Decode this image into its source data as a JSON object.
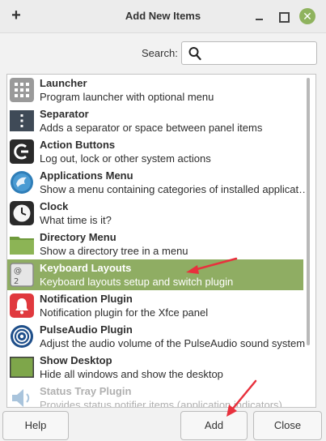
{
  "window": {
    "title": "Add New Items",
    "new_symbol": "+",
    "close_symbol": "✕"
  },
  "search": {
    "label": "Search:",
    "value": "",
    "placeholder": ""
  },
  "items": [
    {
      "name": "Launcher",
      "description": "Program launcher with optional menu",
      "icon": "launcher-grid-icon"
    },
    {
      "name": "Separator",
      "description": "Adds a separator or space between panel items",
      "icon": "separator-icon"
    },
    {
      "name": "Action Buttons",
      "description": "Log out, lock or other system actions",
      "icon": "action-buttons-icon"
    },
    {
      "name": "Applications Menu",
      "description": "Show a menu containing categories of installed applications",
      "icon": "applications-menu-icon"
    },
    {
      "name": "Clock",
      "description": "What time is it?",
      "icon": "clock-icon"
    },
    {
      "name": "Directory Menu",
      "description": "Show a directory tree in a menu",
      "icon": "folder-icon"
    },
    {
      "name": "Keyboard Layouts",
      "description": "Keyboard layouts setup and switch plugin",
      "icon": "keyboard-key-icon"
    },
    {
      "name": "Notification Plugin",
      "description": "Notification plugin for the Xfce panel",
      "icon": "bell-icon"
    },
    {
      "name": "PulseAudio Plugin",
      "description": "Adjust the audio volume of the PulseAudio sound system",
      "icon": "pulseaudio-icon"
    },
    {
      "name": "Show Desktop",
      "description": "Hide all windows and show the desktop",
      "icon": "desktop-icon"
    },
    {
      "name": "Status Tray Plugin",
      "description": "Provides status notifier items (application indicators)",
      "icon": "status-tray-icon"
    }
  ],
  "selected_index": 6,
  "buttons": {
    "help": "Help",
    "add": "Add",
    "close": "Close"
  },
  "colors": {
    "selection": "#8fad63",
    "accent": "#8fb35e",
    "annotation_arrow": "#e8313d"
  }
}
